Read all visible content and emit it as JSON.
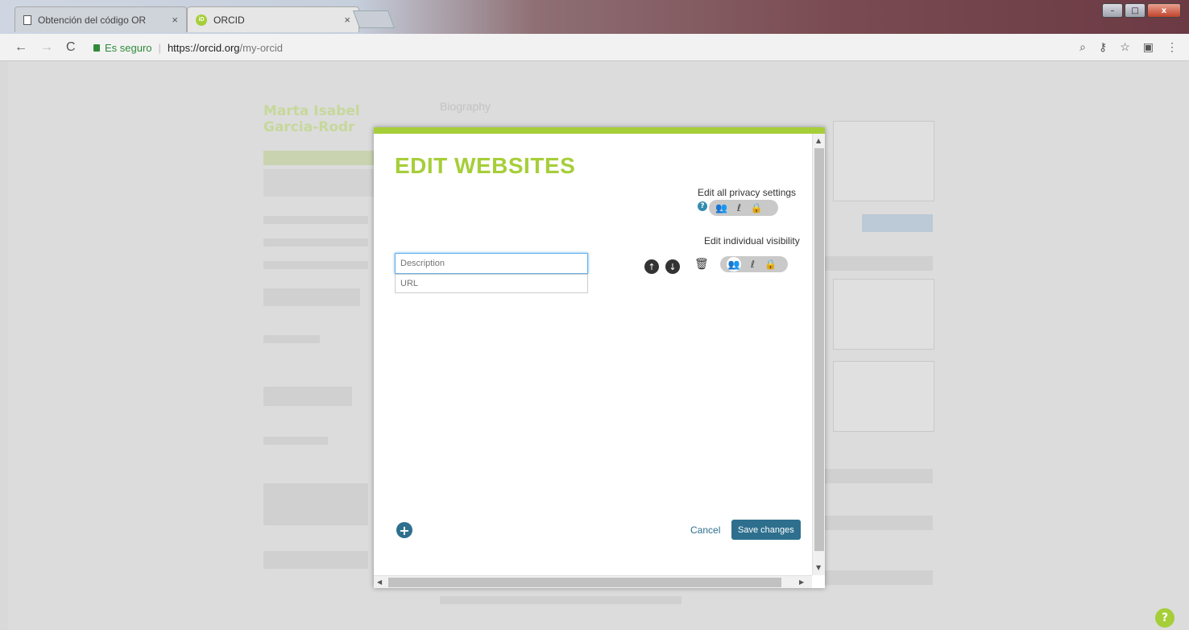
{
  "browser": {
    "tabs": [
      {
        "title": "Obtención del código OR",
        "close": "×"
      },
      {
        "title": "ORCID",
        "close": "×"
      }
    ],
    "secure_label": "Es seguro",
    "url_host": "https://orcid.org",
    "url_path": "/my-orcid",
    "window_buttons": {
      "minimize": "–",
      "maximize": "□",
      "close": "x"
    }
  },
  "modal": {
    "title": "EDIT WEBSITES",
    "edit_all_privacy_label": "Edit all privacy settings",
    "edit_individual_visibility_label": "Edit individual visibility",
    "description_placeholder": "Description",
    "url_placeholder": "URL",
    "cancel_label": "Cancel",
    "save_label": "Save changes",
    "accent_color": "#a6ce39",
    "primary_color": "#2e6f8e"
  },
  "background": {
    "biography_label": "Biography",
    "name_line1": "Marta Isabel",
    "name_line2": "Garcia-Rodr",
    "help_fab": "?"
  }
}
